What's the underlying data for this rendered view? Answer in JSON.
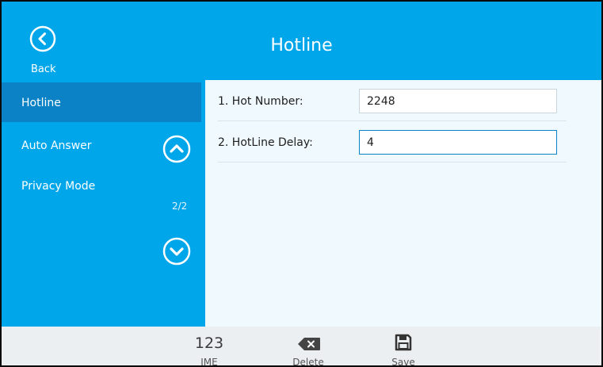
{
  "header": {
    "title": "Hotline",
    "back_label": "Back"
  },
  "sidebar": {
    "items": [
      {
        "label": "Hotline",
        "active": true
      },
      {
        "label": "Auto Answer",
        "active": false
      },
      {
        "label": "Privacy Mode",
        "active": false
      }
    ],
    "page_indicator": "2/2"
  },
  "form": {
    "rows": [
      {
        "label": "1. Hot Number:",
        "value": "2248"
      },
      {
        "label": "2. HotLine Delay:",
        "value": "4"
      }
    ]
  },
  "footer": {
    "ime_top": "123",
    "ime_label": "IME",
    "delete_label": "Delete",
    "save_label": "Save"
  },
  "colors": {
    "header_blue": "#00a6ea",
    "active_item": "#0a82c5",
    "content_bg": "#f0f9fd",
    "footer_bg": "#eceff1"
  },
  "icons": [
    "back-icon",
    "chevron-up-icon",
    "chevron-down-icon",
    "backspace-icon",
    "save-icon"
  ]
}
